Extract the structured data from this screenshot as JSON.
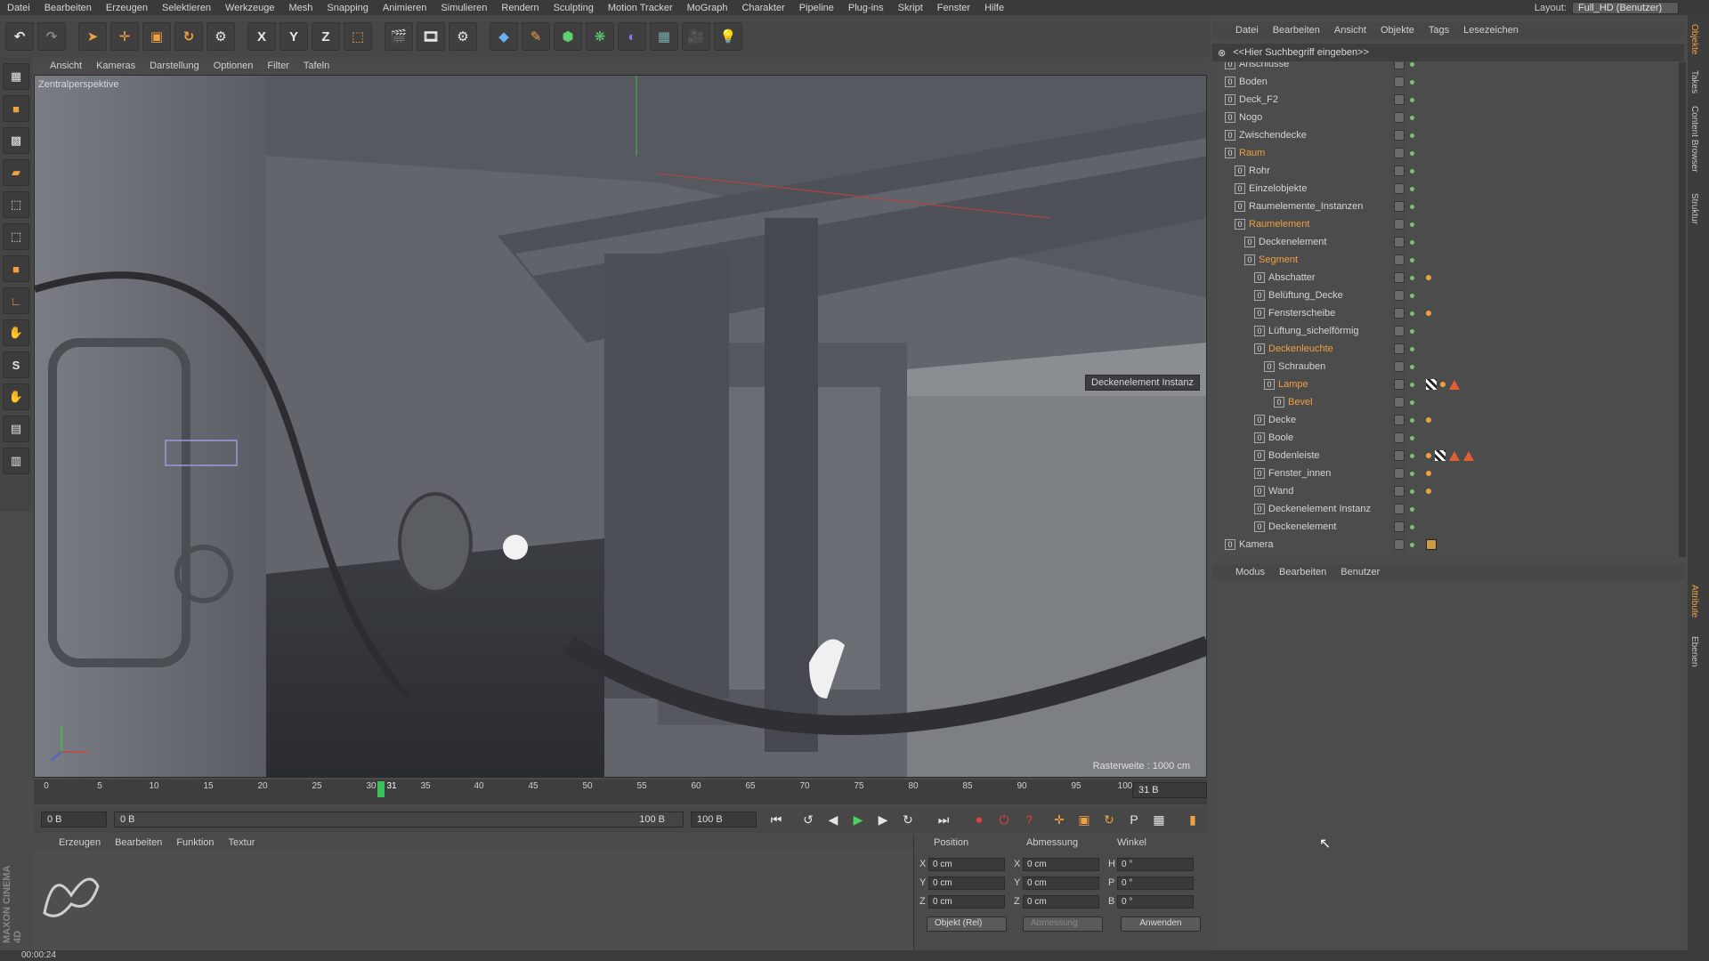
{
  "menubar": {
    "items": [
      "Datei",
      "Bearbeiten",
      "Erzeugen",
      "Selektieren",
      "Werkzeuge",
      "Mesh",
      "Snapping",
      "Animieren",
      "Simulieren",
      "Rendern",
      "Sculpting",
      "Motion Tracker",
      "MoGraph",
      "Charakter",
      "Pipeline",
      "Plug-ins",
      "Skript",
      "Fenster",
      "Hilfe"
    ],
    "layout_label": "Layout:",
    "layout_value": "Full_HD (Benutzer)"
  },
  "toolbar": {
    "x_label": "X",
    "y_label": "Y",
    "z_label": "Z"
  },
  "viewport": {
    "menu": [
      "Ansicht",
      "Kameras",
      "Darstellung",
      "Optionen",
      "Filter",
      "Tafeln"
    ],
    "label": "Zentralperspektive",
    "grid_info": "Rasterweite : 1000 cm",
    "instance_tag": "Deckenelement Instanz"
  },
  "timeline": {
    "ticks": [
      "0",
      "5",
      "10",
      "15",
      "20",
      "25",
      "30",
      "31",
      "35",
      "40",
      "45",
      "50",
      "55",
      "60",
      "65",
      "70",
      "75",
      "80",
      "85",
      "90",
      "95",
      "100"
    ],
    "current_frame": "31 B",
    "start_field": "0 B",
    "range_start": "0 B",
    "range_end": "100 B",
    "end_field": "100 B"
  },
  "material_manager": {
    "menu": [
      "Erzeugen",
      "Bearbeiten",
      "Funktion",
      "Textur"
    ]
  },
  "coordinates": {
    "headers": [
      "Position",
      "Abmessung",
      "Winkel"
    ],
    "rows": [
      {
        "axis": "X",
        "pos": "0 cm",
        "dim_axis": "X",
        "dim": "0 cm",
        "rot_axis": "H",
        "rot": "0 °"
      },
      {
        "axis": "Y",
        "pos": "0 cm",
        "dim_axis": "Y",
        "dim": "0 cm",
        "rot_axis": "P",
        "rot": "0 °"
      },
      {
        "axis": "Z",
        "pos": "0 cm",
        "dim_axis": "Z",
        "dim": "0 cm",
        "rot_axis": "B",
        "rot": "0 °"
      }
    ],
    "mode_select": "Objekt (Rel)",
    "dim_select": "Abmessung",
    "apply_button": "Anwenden"
  },
  "object_manager": {
    "menu": [
      "Datei",
      "Bearbeiten",
      "Ansicht",
      "Objekte",
      "Tags",
      "Lesezeichen"
    ],
    "search_placeholder": "<<Hier Suchbegriff eingeben>>",
    "objects": [
      {
        "name": "Anschlüsse",
        "depth": 0,
        "active": false
      },
      {
        "name": "Boden",
        "depth": 0,
        "active": false
      },
      {
        "name": "Deck_F2",
        "depth": 0,
        "active": false
      },
      {
        "name": "Nogo",
        "depth": 0,
        "active": false
      },
      {
        "name": "Zwischendecke",
        "depth": 0,
        "active": false
      },
      {
        "name": "Raum",
        "depth": 0,
        "active": true
      },
      {
        "name": "Rohr",
        "depth": 1,
        "active": false
      },
      {
        "name": "Einzelobjekte",
        "depth": 1,
        "active": false
      },
      {
        "name": "Raumelemente_Instanzen",
        "depth": 1,
        "active": false
      },
      {
        "name": "Raumelement",
        "depth": 1,
        "active": true
      },
      {
        "name": "Deckenelement",
        "depth": 2,
        "active": false
      },
      {
        "name": "Segment",
        "depth": 2,
        "active": true
      },
      {
        "name": "Abschatter",
        "depth": 3,
        "active": false
      },
      {
        "name": "Belüftung_Decke",
        "depth": 3,
        "active": false
      },
      {
        "name": "Fensterscheibe",
        "depth": 3,
        "active": false
      },
      {
        "name": "Lüftung_sichelförmig",
        "depth": 3,
        "active": false
      },
      {
        "name": "Deckenleuchte",
        "depth": 3,
        "active": true
      },
      {
        "name": "Schrauben",
        "depth": 4,
        "active": false
      },
      {
        "name": "Lampe",
        "depth": 4,
        "active": true
      },
      {
        "name": "Bevel",
        "depth": 5,
        "active": true
      },
      {
        "name": "Decke",
        "depth": 3,
        "active": false
      },
      {
        "name": "Boole",
        "depth": 3,
        "active": false
      },
      {
        "name": "Bodenleiste",
        "depth": 3,
        "active": false
      },
      {
        "name": "Fenster_innen",
        "depth": 3,
        "active": false
      },
      {
        "name": "Wand",
        "depth": 3,
        "active": false
      },
      {
        "name": "Deckenelement Instanz",
        "depth": 3,
        "active": false
      },
      {
        "name": "Deckenelement",
        "depth": 3,
        "active": false
      },
      {
        "name": "Kamera",
        "depth": 0,
        "active": false
      }
    ]
  },
  "attribute_manager": {
    "menu": [
      "Modus",
      "Bearbeiten",
      "Benutzer"
    ]
  },
  "right_tabs": [
    "Objekte",
    "Takes",
    "Content Browser",
    "Struktur",
    "Attribute",
    "Ebenen"
  ],
  "branding": "MAXON CINEMA 4D",
  "status": {
    "time": "00:00:24"
  }
}
